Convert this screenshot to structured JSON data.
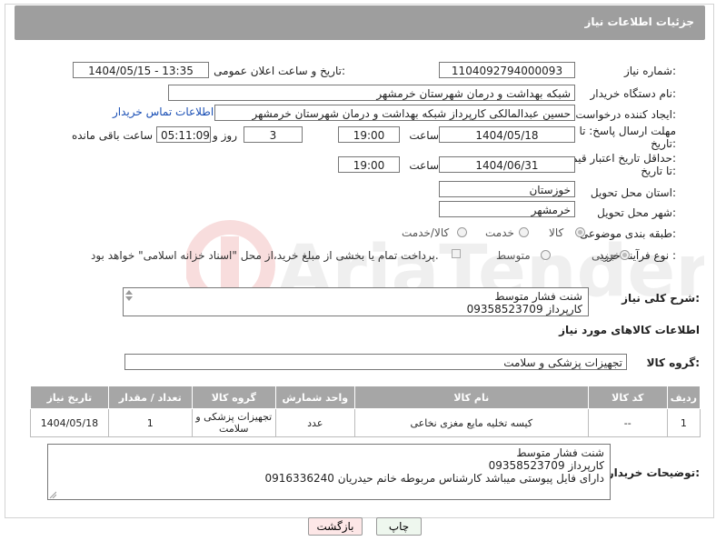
{
  "header": {
    "title": "جزئیات اطلاعات نیاز"
  },
  "fields": {
    "need_number_label": "شماره نیاز:",
    "need_number": "1104092794000093",
    "announce_label": "تاریخ و ساعت اعلان عمومی:",
    "announce_value": "1404/05/15 - 13:35",
    "buyer_org_label": "نام دستگاه خریدار:",
    "buyer_org": "شبکه بهداشت و درمان شهرستان خرمشهر",
    "creator_label": "ایجاد کننده درخواست:",
    "creator": "حسین عبدالمالکی کارپرداز شبکه بهداشت و درمان شهرستان خرمشهر",
    "contact_link": "اطلاعات تماس خریدار",
    "deadline_label_1": "مهلت ارسال پاسخ: تا",
    "deadline_label_2": "تاریخ:",
    "deadline_date": "1404/05/18",
    "time_label": "ساعت",
    "deadline_time": "19:00",
    "days_value": "3",
    "days_label": "روز و",
    "remaining_time": "05:11:09",
    "remaining_label": "ساعت باقی مانده",
    "price_label_1": "حداقل تاریخ اعتبار قیمت:",
    "price_label_2": "تا تاریخ:",
    "price_date": "1404/06/31",
    "price_time": "19:00",
    "province_label": "استان محل تحویل:",
    "province": "خوزستان",
    "city_label": "شهر محل تحویل:",
    "city": "خرمشهر",
    "category_label": "طبقه بندی موضوعی:",
    "category_options": [
      "کالا",
      "خدمت",
      "کالا/خدمت"
    ],
    "purchase_label": "نوع فرآیند خرید :",
    "purchase_options": [
      "جزیی",
      "متوسط"
    ],
    "payment_note": "پرداخت تمام یا بخشی از مبلغ خرید،از محل \"اسناد خزانه اسلامی\" خواهد بود."
  },
  "description": {
    "label": "شرح کلی نیاز:",
    "lines": [
      "شنت فشار متوسط",
      "کارپرداز 09358523709"
    ]
  },
  "goods": {
    "section_title": "اطلاعات کالاهای مورد نیاز",
    "group_label": "گروه کالا:",
    "group_value": "تجهیزات پزشکی و سلامت"
  },
  "table": {
    "headers": [
      "ردیف",
      "کد کالا",
      "نام کالا",
      "واحد شمارش",
      "گروه کالا",
      "تعداد / مقدار",
      "تاریخ نیاز"
    ],
    "rows": [
      [
        "1",
        "--",
        "کیسه تخلیه مایع مغزی نخاعی",
        "عدد",
        "تجهیزات پزشکی و سلامت",
        "1",
        "1404/05/18"
      ]
    ]
  },
  "buyer_notes": {
    "label": "توضیحات خریدار:",
    "lines": [
      "شنت فشار متوسط",
      "کارپرداز 09358523709",
      "دارای فایل پیوستی میباشد کارشناس مربوطه خانم حیدریان 0916336240"
    ]
  },
  "buttons": {
    "print": "چاپ",
    "back": "بازگشت"
  },
  "colors": {
    "header_bg": "#9e9e9e",
    "link": "#1a4fb5",
    "back_btn_bg": "#fde7e7",
    "print_btn_bg": "#eef7ee"
  }
}
